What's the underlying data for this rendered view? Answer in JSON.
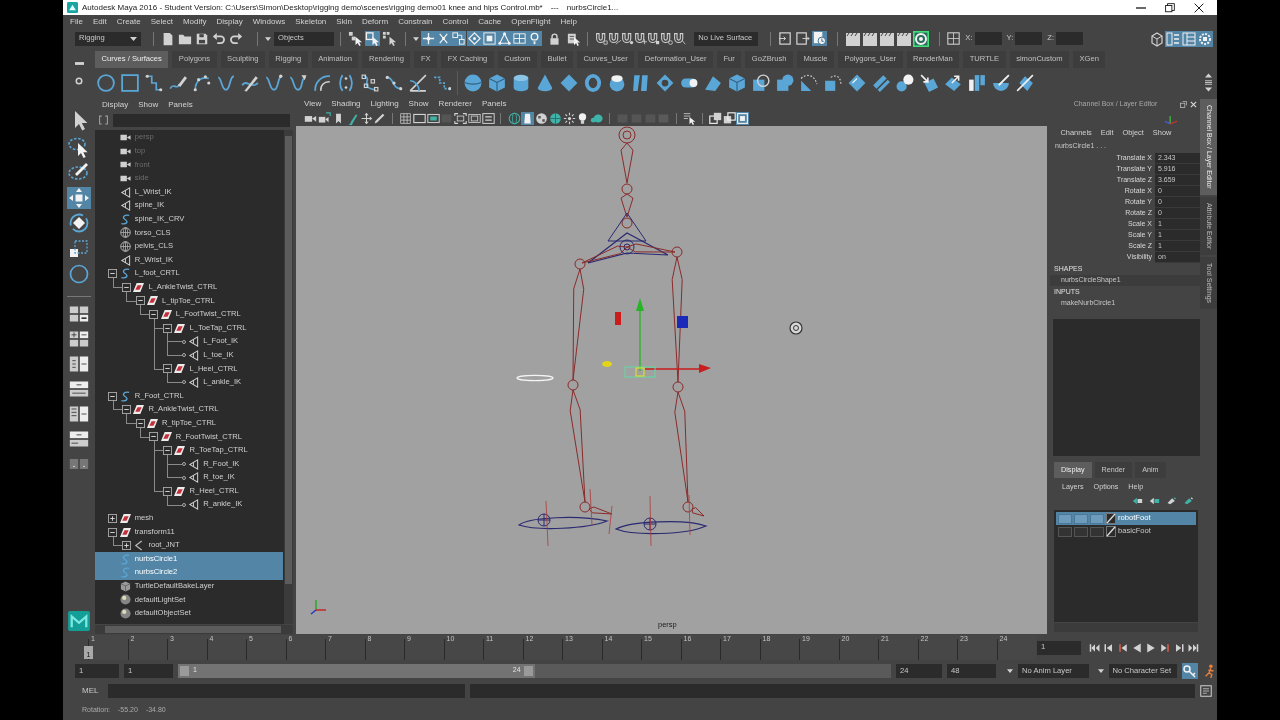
{
  "window": {
    "title": "Autodesk Maya 2016 - Student Version: C:\\Users\\Simon\\Desktop\\rigging demo\\scenes\\rigging demo01 knee and hips Control.mb*",
    "separator": "---",
    "active_object": "nurbsCircle1..."
  },
  "menu_bar": [
    "File",
    "Edit",
    "Create",
    "Select",
    "Modify",
    "Display",
    "Windows",
    "Skeleton",
    "Skin",
    "Deform",
    "Constrain",
    "Control",
    "Cache",
    "OpenFlight",
    "Help"
  ],
  "status_line": {
    "menu_set": "Rigging",
    "selection_field": "Objects",
    "select_mode_buttons": [
      {
        "on": false
      },
      {
        "on": true
      },
      {
        "on": false
      }
    ],
    "mask_buttons": [
      {
        "on": true
      },
      {
        "on": true
      },
      {
        "on": true
      },
      {
        "on": true
      },
      {
        "on": true
      },
      {
        "on": true
      },
      {
        "on": true
      },
      {
        "on": true
      }
    ],
    "snap_buttons": [
      {
        "on": false
      },
      {
        "on": false
      },
      {
        "on": false
      },
      {
        "on": false
      },
      {
        "on": false
      },
      {
        "on": false
      },
      {
        "on": false
      }
    ],
    "live_surface": "No Live Surface",
    "history_buttons": [
      {
        "on": false
      },
      {
        "on": false
      },
      {
        "on": true
      }
    ],
    "render_buttons": [
      {
        "on": false
      },
      {
        "on": false
      },
      {
        "on": false
      },
      {
        "on": false
      },
      {
        "on": true
      }
    ],
    "coordinates": [
      "X:",
      "Y:",
      "Z:"
    ],
    "panel_buttons": [
      {
        "on": false
      },
      {
        "on": true
      },
      {
        "on": true
      },
      {
        "on": true
      }
    ]
  },
  "shelf": {
    "tabs": [
      {
        "label": "Curves / Surfaces",
        "selected": true
      },
      {
        "label": "Polygons",
        "selected": false
      },
      {
        "label": "Sculpting",
        "selected": false
      },
      {
        "label": "Rigging",
        "selected": false
      },
      {
        "label": "Animation",
        "selected": false
      },
      {
        "label": "Rendering",
        "selected": false
      },
      {
        "label": "FX",
        "selected": false
      },
      {
        "label": "FX Caching",
        "selected": false
      },
      {
        "label": "Custom",
        "selected": false
      },
      {
        "label": "Bullet",
        "selected": false
      },
      {
        "label": "Curves_User",
        "selected": false
      },
      {
        "label": "Deformation_User",
        "selected": false
      },
      {
        "label": "Fur",
        "selected": false
      },
      {
        "label": "GoZBrush",
        "selected": false
      },
      {
        "label": "Muscle",
        "selected": false
      },
      {
        "label": "Polygons_User",
        "selected": false
      },
      {
        "label": "RenderMan",
        "selected": false
      },
      {
        "label": "TURTLE",
        "selected": false
      },
      {
        "label": "simonCustom",
        "selected": false
      },
      {
        "label": "XGen",
        "selected": false
      }
    ]
  },
  "tool_box": {
    "tools": [
      {
        "selected": false
      },
      {
        "selected": false
      },
      {
        "selected": false
      },
      {
        "selected": true
      },
      {
        "selected": false
      },
      {
        "selected": false
      },
      {
        "selected": false
      }
    ]
  },
  "outliner": {
    "menu": [
      "Display",
      "Show",
      "Panels"
    ],
    "items": [
      {
        "name": "persp",
        "kind": "camera",
        "hidden": true,
        "selected": false
      },
      {
        "name": "top",
        "kind": "camera",
        "hidden": true,
        "selected": false
      },
      {
        "name": "front",
        "kind": "camera",
        "hidden": true,
        "selected": false
      },
      {
        "name": "side",
        "kind": "camera",
        "hidden": true,
        "selected": false
      },
      {
        "name": "L_Wrist_IK",
        "kind": "ikHandle",
        "hidden": false,
        "selected": false
      },
      {
        "name": "spine_IK",
        "kind": "ikHandle",
        "hidden": false,
        "selected": false
      },
      {
        "name": "spine_IK_CRV",
        "kind": "curve",
        "hidden": false,
        "selected": false
      },
      {
        "name": "torso_CLS",
        "kind": "cluster",
        "hidden": false,
        "selected": false
      },
      {
        "name": "pelvis_CLS",
        "kind": "cluster",
        "hidden": false,
        "selected": false
      },
      {
        "name": "R_Wrist_IK",
        "kind": "ikHandle",
        "hidden": false,
        "selected": false
      },
      {
        "name": "L_foot_CRTL",
        "kind": "curve",
        "hidden": false,
        "selected": false,
        "expanded": true,
        "children": [
          {
            "name": "L_AnkleTwist_CTRL",
            "kind": "transform",
            "hidden": false,
            "selected": false,
            "expanded": true,
            "children": [
              {
                "name": "L_tipToe_CTRL",
                "kind": "transform",
                "hidden": false,
                "selected": false,
                "expanded": true,
                "children": [
                  {
                    "name": "L_FootTwist_CTRL",
                    "kind": "transform",
                    "hidden": false,
                    "selected": false,
                    "expanded": true,
                    "children": [
                      {
                        "name": "L_ToeTap_CTRL",
                        "kind": "transform",
                        "hidden": false,
                        "selected": false,
                        "expanded": true,
                        "children": [
                          {
                            "name": "L_Foot_IK",
                            "kind": "ikHandle",
                            "hidden": false,
                            "selected": false
                          },
                          {
                            "name": "L_toe_IK",
                            "kind": "ikHandle",
                            "hidden": false,
                            "selected": false
                          }
                        ]
                      },
                      {
                        "name": "L_Heel_CTRL",
                        "kind": "transform",
                        "hidden": false,
                        "selected": false,
                        "expanded": true,
                        "children": [
                          {
                            "name": "L_ankle_IK",
                            "kind": "ikHandle",
                            "hidden": false,
                            "selected": false
                          }
                        ]
                      }
                    ]
                  }
                ]
              }
            ]
          }
        ]
      },
      {
        "name": "R_Foot_CTRL",
        "kind": "curve",
        "hidden": false,
        "selected": false,
        "expanded": true,
        "children": [
          {
            "name": "R_AnkleTwist_CTRL",
            "kind": "transform",
            "hidden": false,
            "selected": false,
            "expanded": true,
            "children": [
              {
                "name": "R_tipToe_CTRL",
                "kind": "transform",
                "hidden": false,
                "selected": false,
                "expanded": true,
                "children": [
                  {
                    "name": "R_FootTwist_CTRL",
                    "kind": "transform",
                    "hidden": false,
                    "selected": false,
                    "expanded": true,
                    "children": [
                      {
                        "name": "R_ToeTap_CTRL",
                        "kind": "transform",
                        "hidden": false,
                        "selected": false,
                        "expanded": true,
                        "children": [
                          {
                            "name": "R_Foot_IK",
                            "kind": "ikHandle",
                            "hidden": false,
                            "selected": false
                          },
                          {
                            "name": "R_toe_IK",
                            "kind": "ikHandle",
                            "hidden": false,
                            "selected": false
                          }
                        ]
                      },
                      {
                        "name": "R_Heel_CTRL",
                        "kind": "transform",
                        "hidden": false,
                        "selected": false,
                        "expanded": true,
                        "children": [
                          {
                            "name": "R_ankle_IK",
                            "kind": "ikHandle",
                            "hidden": false,
                            "selected": false
                          }
                        ]
                      }
                    ]
                  }
                ]
              }
            ]
          }
        ]
      },
      {
        "name": "mesh",
        "kind": "transform",
        "hidden": false,
        "selected": false,
        "expanded": false
      },
      {
        "name": "transform11",
        "kind": "transform",
        "hidden": false,
        "selected": false,
        "expanded": true,
        "children": [
          {
            "name": "root_JNT",
            "kind": "joint",
            "hidden": false,
            "selected": false,
            "expanded": false
          }
        ]
      },
      {
        "name": "nurbsCircle1",
        "kind": "curve",
        "hidden": false,
        "selected": true
      },
      {
        "name": "nurbsCircle2",
        "kind": "curve",
        "hidden": false,
        "selected": true
      },
      {
        "name": "TurtleDefaultBakeLayer",
        "kind": "bakeLayer",
        "hidden": false,
        "selected": false
      },
      {
        "name": "defaultLightSet",
        "kind": "set",
        "hidden": false,
        "selected": false
      },
      {
        "name": "defaultObjectSet",
        "kind": "set",
        "hidden": false,
        "selected": false
      }
    ]
  },
  "viewport": {
    "menu": [
      "View",
      "Shading",
      "Lighting",
      "Show",
      "Renderer",
      "Panels"
    ],
    "toolbar_buttons": [
      {
        "on": false
      },
      {
        "on": false
      },
      {
        "on": false
      },
      {
        "on": false
      },
      {
        "on": false
      },
      {
        "on": false
      },
      {
        "on": false
      },
      {
        "on": false
      },
      {
        "on": false
      },
      {
        "on": false
      },
      {
        "on": false
      },
      {
        "on": false
      },
      {
        "on": false
      },
      {
        "on": false
      },
      {
        "on": true
      },
      {
        "on": false
      },
      {
        "on": false
      },
      {
        "on": false
      },
      {
        "on": false
      },
      {
        "on": false
      },
      {
        "on": false
      },
      {
        "on": false
      },
      {
        "on": false
      },
      {
        "on": false
      },
      {
        "on": false
      },
      {
        "on": false
      },
      {
        "on": false
      },
      {
        "on": true
      }
    ],
    "camera": "persp"
  },
  "channel_box": {
    "title": "Channel Box / Layer Editor",
    "menu": [
      "Channels",
      "Edit",
      "Object",
      "Show"
    ],
    "object": "nurbsCircle1 . . .",
    "channels": [
      {
        "name": "Translate X",
        "value": "2.343"
      },
      {
        "name": "Translate Y",
        "value": "5.916"
      },
      {
        "name": "Translate Z",
        "value": "3.659"
      },
      {
        "name": "Rotate X",
        "value": "0"
      },
      {
        "name": "Rotate Y",
        "value": "0"
      },
      {
        "name": "Rotate Z",
        "value": "0"
      },
      {
        "name": "Scale X",
        "value": "1"
      },
      {
        "name": "Scale Y",
        "value": "1"
      },
      {
        "name": "Scale Z",
        "value": "1"
      },
      {
        "name": "Visibility",
        "value": "on"
      }
    ],
    "shapes_heading": "SHAPES",
    "shapes": [
      "nurbsCircleShape1"
    ],
    "inputs_heading": "INPUTS",
    "inputs": [
      "makeNurbCircle1"
    ]
  },
  "layer_editor": {
    "tabs": [
      {
        "label": "Display",
        "selected": true
      },
      {
        "label": "Render",
        "selected": false
      },
      {
        "label": "Anim",
        "selected": false
      }
    ],
    "menu": [
      "Layers",
      "Options",
      "Help"
    ],
    "layers": [
      {
        "name": "robotFoot",
        "selected": true
      },
      {
        "name": "basicFoot",
        "selected": false
      }
    ]
  },
  "side_tabs": [
    {
      "label": "Channel Box / Layer Editor",
      "selected": true
    },
    {
      "label": "Attribute Editor",
      "selected": false
    },
    {
      "label": "Tool Settings",
      "selected": false
    }
  ],
  "time_slider": {
    "ticks": [
      "1",
      "2",
      "3",
      "4",
      "5",
      "6",
      "7",
      "8",
      "9",
      "10",
      "11",
      "12",
      "13",
      "14",
      "15",
      "16",
      "17",
      "18",
      "19",
      "20",
      "21",
      "22",
      "23",
      "24"
    ],
    "marker": "1",
    "level": 0,
    "current_frame": "1"
  },
  "range_slider": {
    "animation_start": "1",
    "playback_start": "1",
    "range_start_label": "1",
    "range_end_label": "24",
    "level": 0.5,
    "playback_end": "24",
    "animation_end": "48",
    "anim_layer": "No Anim Layer",
    "character_set": "No Character Set"
  },
  "command_line": {
    "language": "MEL"
  },
  "help_line": {
    "label": "Rotation:",
    "values": [
      "-55.20",
      "-34.80"
    ]
  }
}
